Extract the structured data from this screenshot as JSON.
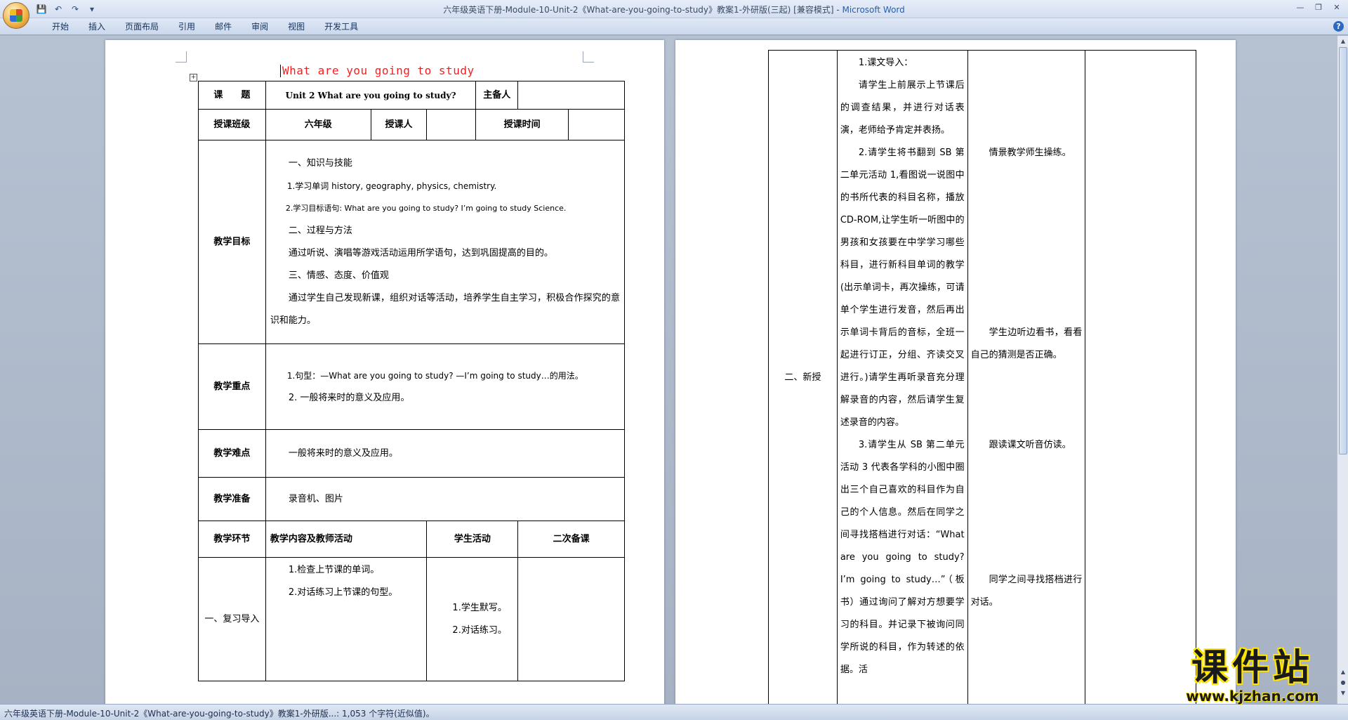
{
  "window": {
    "title": "六年级英语下册-Module-10-Unit-2《What-are-you-going-to-study》教案1-外研版(三起) [兼容模式] - ",
    "app_name": "Microsoft Word"
  },
  "ribbon": {
    "tabs": [
      "开始",
      "插入",
      "页面布局",
      "引用",
      "邮件",
      "审阅",
      "视图",
      "开发工具"
    ]
  },
  "status_bar": {
    "text": "六年级英语下册-Module-10-Unit-2《What-are-you-going-to-study》教案1-外研版...: 1,053 个字符(近似值)。"
  },
  "doc": {
    "title": "What are you going to study",
    "left_table": {
      "topic_label": "课　　题",
      "topic_value": "Unit 2 What are you going to study?",
      "preparer_label": "主备人",
      "class_label": "授课班级",
      "class_value": "六年级",
      "teacher_label": "授课人",
      "time_label": "授课时间",
      "goals_label": "教学目标",
      "goals": [
        "一、知识与技能",
        "1.学习单词 history, geography, physics, chemistry.",
        "2.学习目标语句: What are you going to study? I’m going to study Science.",
        "二、过程与方法",
        "通过听说、演唱等游戏活动运用所学语句，达到巩固提高的目的。",
        "三、情感、态度、价值观",
        "通过学生自己发现新课，组织对话等活动，培养学生自主学习，积极合作探究的意识和能力。"
      ],
      "key_label": "教学重点",
      "key_points": [
        "1.句型：—What are you going to study? —I’m going to study…的用法。",
        "2. 一般将来时的意义及应用。"
      ],
      "difficulty_label": "教学难点",
      "difficulty": "一般将来时的意义及应用。",
      "prep_label": "教学准备",
      "prep": "录音机、图片",
      "stage_header": "教学环节",
      "content_header": "教学内容及教师活动",
      "student_header": "学生活动",
      "second_header": "二次备课",
      "stage1": "一、复习导入",
      "stage1_content": [
        "1.检查上节课的单词。",
        "2.对话练习上节课的句型。"
      ],
      "stage1_student": [
        "1.学生默写。",
        "2.对话练习。"
      ]
    },
    "right_table": {
      "stage": "二、新授",
      "content": [
        "1.课文导入：",
        "请学生上前展示上节课后的调查结果，并进行对话表演，老师给予肯定并表扬。",
        "2.请学生将书翻到 SB 第二单元活动 1,看图说一说图中的书所代表的科目名称，播放 CD-ROM,让学生听一听图中的男孩和女孩要在中学学习哪些科目，进行新科目单词的教学(出示单词卡，再次操练，可请单个学生进行发音，然后再出示单词卡背后的音标，全班一起进行订正，分组、齐读交叉进行。)请学生再听录音充分理解录音的内容，然后请学生复述录音的内容。",
        "3.请学生从 SB 第二单元活动 3 代表各学科的小图中圈出三个自己喜欢的科目作为自己的个人信息。然后在同学之间寻找搭档进行对话：“What are you going to study? I’m going to study…”（板书）通过询问了解对方想要学习的科目。并记录下被询问同学所说的科目，作为转述的依据。活"
      ],
      "student": [
        "情景教学师生操练。",
        "学生边听边看书，看看自己的猜测是否正确。",
        "跟读课文听音仿读。",
        "同学之间寻找搭档进行对话。"
      ]
    }
  },
  "watermark": {
    "main": "课件站",
    "sub": "www.kjzhan.com"
  },
  "colors": {
    "title_red": "#ff1a1a",
    "ribbon_blue": "#cbd8ec",
    "app_blue": "#1f5fb5"
  }
}
